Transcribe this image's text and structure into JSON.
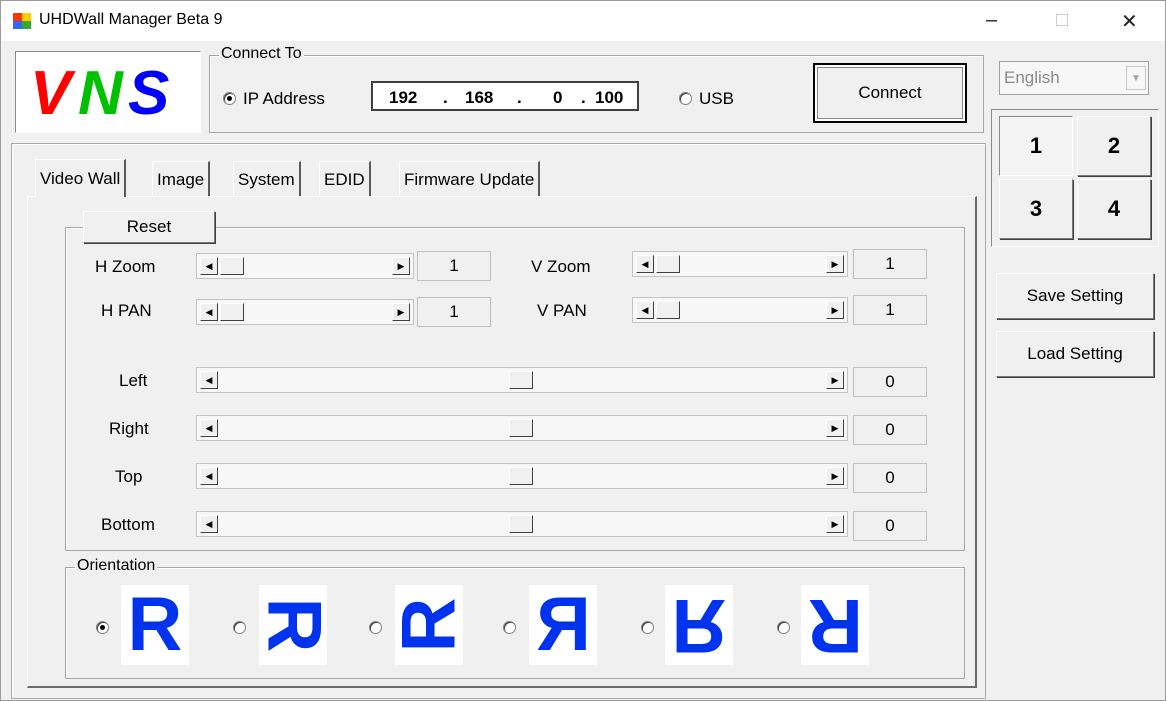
{
  "window": {
    "title": "UHDWall Manager Beta  9",
    "minimize": "–",
    "maximize": "□",
    "close": "✕"
  },
  "logo": {
    "text": "VNS",
    "colors": [
      "#ff0000",
      "#00c000",
      "#0000ff"
    ]
  },
  "connect": {
    "legend": "Connect To",
    "ip_label": "IP Address",
    "ip_octets": [
      "192",
      "168",
      "0",
      "100"
    ],
    "usb_label": "USB",
    "button": "Connect",
    "selected": "ip"
  },
  "language": {
    "value": "English"
  },
  "quad_buttons": [
    "1",
    "2",
    "3",
    "4"
  ],
  "side_buttons": {
    "save": "Save Setting",
    "load": "Load Setting"
  },
  "tabs": [
    "Video Wall",
    "Image",
    "System",
    "EDID",
    "Firmware Update"
  ],
  "active_tab": 0,
  "video_wall": {
    "reset": "Reset",
    "h_zoom": {
      "label": "H Zoom",
      "value": "1"
    },
    "v_zoom": {
      "label": "V Zoom",
      "value": "1"
    },
    "h_pan": {
      "label": "H PAN",
      "value": "1"
    },
    "v_pan": {
      "label": "V PAN",
      "value": "1"
    },
    "left": {
      "label": "Left",
      "value": "0"
    },
    "right": {
      "label": "Right",
      "value": "0"
    },
    "top": {
      "label": "Top",
      "value": "0"
    },
    "bottom": {
      "label": "Bottom",
      "value": "0"
    }
  },
  "orientation": {
    "legend": "Orientation",
    "options": [
      {
        "glyph": "R",
        "transform": "normal",
        "selected": true
      },
      {
        "glyph": "R",
        "transform": "rotate-90",
        "selected": false
      },
      {
        "glyph": "R",
        "transform": "rotate-270",
        "selected": false
      },
      {
        "glyph": "R",
        "transform": "mirror-horizontal",
        "selected": false
      },
      {
        "glyph": "R",
        "transform": "mirror-vertical",
        "selected": false
      },
      {
        "glyph": "R",
        "transform": "rotate-180",
        "selected": false
      }
    ],
    "color": "#0033ee"
  }
}
